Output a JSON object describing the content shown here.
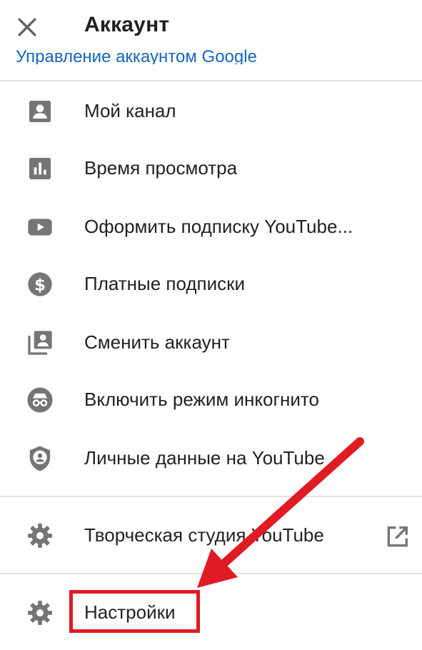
{
  "header": {
    "title": "Аккаунт",
    "close_icon": "close-icon"
  },
  "manage_link": "Управление аккаунтом Google",
  "menu": {
    "my_channel": {
      "label": "Мой канал",
      "icon": "account-box-icon"
    },
    "watch_time": {
      "label": "Время просмотра",
      "icon": "bar-chart-icon"
    },
    "youtube_premium": {
      "label": "Оформить подписку YouTube...",
      "icon": "youtube-play-icon"
    },
    "paid_memberships": {
      "label": "Платные подписки",
      "icon": "dollar-circle-icon"
    },
    "switch_account": {
      "label": "Сменить аккаунт",
      "icon": "switch-account-icon"
    },
    "incognito": {
      "label": "Включить режим инкогнито",
      "icon": "incognito-icon"
    },
    "your_data": {
      "label": "Личные данные на YouTube",
      "icon": "shield-person-icon"
    },
    "studio": {
      "label": "Творческая студия YouTube",
      "icon": "gear-icon",
      "external_icon": "open-in-new-icon"
    },
    "settings": {
      "label": "Настройки",
      "icon": "gear-icon"
    }
  },
  "colors": {
    "link": "#1565c0",
    "icon": "#757575",
    "annotation": "#e01b24"
  }
}
